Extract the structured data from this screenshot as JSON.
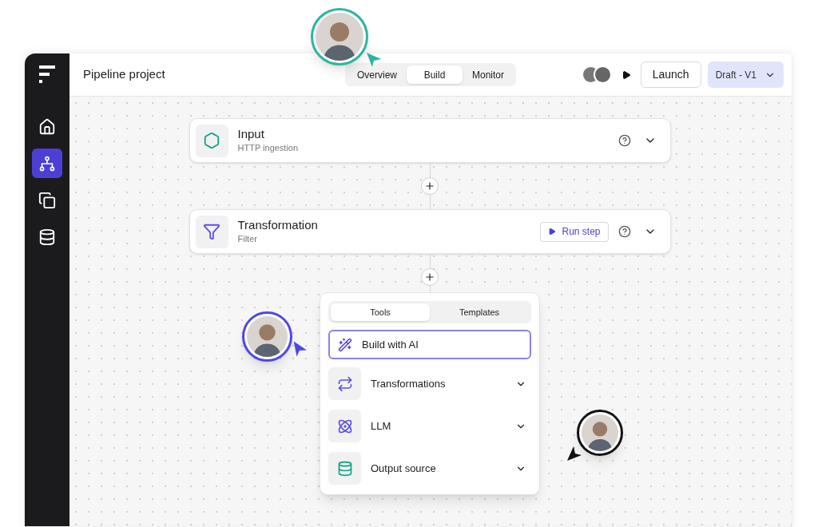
{
  "sidebar": {
    "items": [
      {
        "kind": "home",
        "selected": false
      },
      {
        "kind": "pipeline",
        "selected": true
      },
      {
        "kind": "copy",
        "selected": false
      },
      {
        "kind": "database",
        "selected": false
      }
    ]
  },
  "header": {
    "title": "Pipeline project",
    "tabs": [
      {
        "label": "Overview",
        "selected": false
      },
      {
        "label": "Build",
        "selected": true
      },
      {
        "label": "Monitor",
        "selected": false
      }
    ],
    "launch": "Launch",
    "version": "Draft - V1"
  },
  "steps": [
    {
      "kind": "input",
      "title": "Input",
      "subtitle": "HTTP ingestion"
    },
    {
      "kind": "filter",
      "title": "Transformation",
      "subtitle": "Filter",
      "run_button": "Run step"
    }
  ],
  "menu": {
    "tabs": [
      {
        "label": "Tools",
        "selected": true
      },
      {
        "label": "Templates",
        "selected": false
      }
    ],
    "ai_button": "Build with AI",
    "items": [
      {
        "kind": "transform",
        "label": "Transformations"
      },
      {
        "kind": "llm",
        "label": "LLM"
      },
      {
        "kind": "output",
        "label": "Output source"
      }
    ]
  },
  "cursors": [
    {
      "color": "#2bb5a0"
    },
    {
      "color": "#4f46e5"
    },
    {
      "color": "#111111"
    }
  ]
}
